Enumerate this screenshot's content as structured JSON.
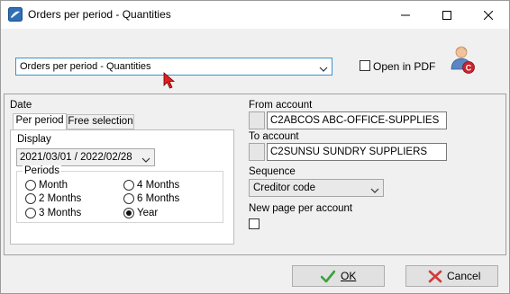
{
  "window": {
    "title": "Orders per period - Quantities",
    "controls": [
      "minimize-icon",
      "maximize-icon",
      "close-icon"
    ]
  },
  "report": {
    "selected": "Orders per period - Quantities",
    "open_in_pdf_label": "Open in PDF",
    "open_in_pdf_checked": false,
    "user_badge": "C"
  },
  "date": {
    "section_label": "Date",
    "tabs": [
      "Per period",
      "Free selection"
    ],
    "active_tab": "Per period",
    "display_label": "Display",
    "display_value": "2021/03/01 / 2022/02/28",
    "periods_label": "Periods",
    "periods": [
      {
        "label": "Month",
        "checked": false
      },
      {
        "label": "2 Months",
        "checked": false
      },
      {
        "label": "3 Months",
        "checked": false
      },
      {
        "label": "4 Months",
        "checked": false
      },
      {
        "label": "6 Months",
        "checked": false
      },
      {
        "label": "Year",
        "checked": true
      }
    ]
  },
  "accounts": {
    "from_label": "From account",
    "from_value": "C2ABCOS ABC-OFFICE-SUPPLIES",
    "to_label": "To account",
    "to_value": "C2SUNSU SUNDRY SUPPLIERS"
  },
  "sequence": {
    "label": "Sequence",
    "value": "Creditor code"
  },
  "new_page": {
    "label": "New page per account",
    "checked": false
  },
  "buttons": {
    "ok_label": "OK",
    "cancel_label": "Cancel"
  },
  "colors": {
    "accent_border": "#3c93c9",
    "ok_check": "#3aa23a",
    "cancel_x": "#d23a3a",
    "cursor": "#e02020"
  }
}
